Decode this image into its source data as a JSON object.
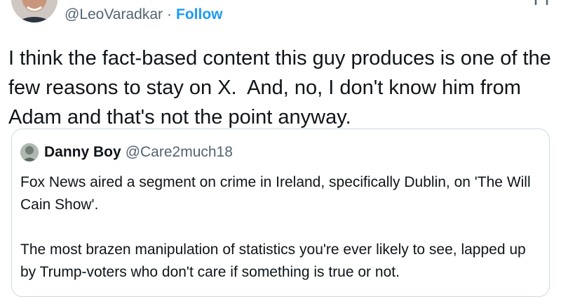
{
  "tweet": {
    "handle": "@LeoVaradkar",
    "separator": "·",
    "follow_label": "Follow",
    "text": "I think the fact-based content this guy produces is one of the few reasons to stay on X.  And, no, I don't know him from Adam and that's not the point anyway."
  },
  "quote": {
    "display_name": "Danny Boy",
    "handle": "@Care2much18",
    "paragraph_1": "Fox News aired a segment on crime in Ireland, specifically Dublin, on 'The Will Cain Show'.",
    "paragraph_2": "The most brazen manipulation of statistics you're ever likely to see, lapped up by Trump-voters who don't care if something is true or not."
  },
  "icons": {
    "author_avatar": "avatar",
    "quote_avatar": "avatar",
    "more": "more-options-icon"
  },
  "colors": {
    "link_blue": "#1d9bf0",
    "secondary_text": "#536471",
    "primary_text": "#0f1419",
    "border": "#cfd9de"
  }
}
